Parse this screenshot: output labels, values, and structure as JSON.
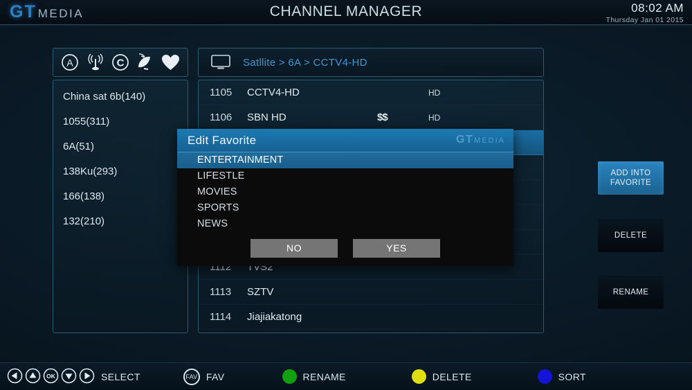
{
  "header": {
    "brand_gt": "GT",
    "brand_media": "MEDIA",
    "title": "CHANNEL MANAGER",
    "time": "08:02 AM",
    "date": "Thursday Jan 01 2015"
  },
  "icon_bar": {
    "icons": [
      {
        "name": "circled-a-icon",
        "label": "A"
      },
      {
        "name": "antenna-icon",
        "label": "Antenna"
      },
      {
        "name": "circled-c-icon",
        "label": "C"
      },
      {
        "name": "satellite-dish-icon",
        "label": "Satellite"
      },
      {
        "name": "heart-icon",
        "label": "Favorite"
      }
    ]
  },
  "sidebar": {
    "items": [
      {
        "label": "China sat 6b(140)"
      },
      {
        "label": "1055(311)"
      },
      {
        "label": "6A(51)"
      },
      {
        "label": "138Ku(293)"
      },
      {
        "label": "166(138)"
      },
      {
        "label": "132(210)"
      }
    ]
  },
  "main": {
    "breadcrumb": "Satllite > 6A > CCTV4-HD",
    "channels": [
      {
        "number": "1105",
        "name": "CCTV4-HD",
        "price": "",
        "quality": "HD"
      },
      {
        "number": "1106",
        "name": "SBN HD",
        "price": "$$",
        "quality": "HD"
      },
      {
        "number": "1112",
        "name": "TVS2",
        "price": "",
        "quality": ""
      },
      {
        "number": "1113",
        "name": "SZTV",
        "price": "",
        "quality": ""
      },
      {
        "number": "1114",
        "name": "Jiajiakatong",
        "price": "",
        "quality": ""
      }
    ]
  },
  "side_buttons": {
    "add_into_favorite": "ADD INTO\nFAVORITE",
    "add_into_favorite_line1": "ADD INTO",
    "add_into_favorite_line2": "FAVORITE",
    "delete": "DELETE",
    "rename": "RENAME"
  },
  "dialog": {
    "title": "Edit Favorite",
    "brand_gt": "GT",
    "brand_media": "MEDIA",
    "options": [
      {
        "label": "ENTERTAINMENT",
        "selected": true
      },
      {
        "label": "LIFESTLE",
        "selected": false
      },
      {
        "label": "MOVIES",
        "selected": false
      },
      {
        "label": "SPORTS",
        "selected": false
      },
      {
        "label": "NEWS",
        "selected": false
      }
    ],
    "no_label": "NO",
    "yes_label": "YES"
  },
  "bottom_bar": {
    "select_label": "SELECT",
    "fav_key_label": "FAV",
    "fav_label": "FAV",
    "rename_label": "RENAME",
    "delete_label": "DELETE",
    "sort_label": "SORT",
    "ok_key_label": "OK",
    "colors": {
      "green": "#12a012",
      "yellow": "#dede10",
      "blue": "#1414d8",
      "accent_blue": "#3f95d6"
    }
  }
}
